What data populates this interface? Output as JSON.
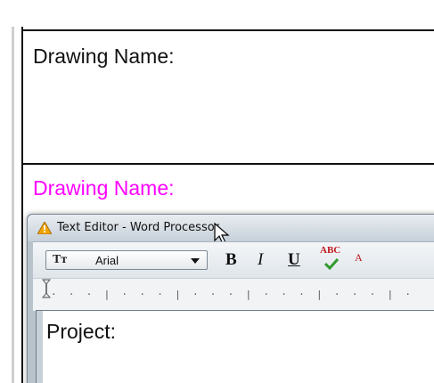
{
  "sheet": {
    "label_black": "Drawing Name:",
    "label_magenta": "Drawing Name:",
    "magenta_color": "#ff00ff"
  },
  "editor": {
    "title": "Text Editor - Word Processor",
    "app_icon": "warning-icon",
    "toolbar": {
      "font_icon": "font-icon",
      "font_glyph": "Tт",
      "font_name": "Arial",
      "bold_label": "B",
      "italic_label": "I",
      "underline_label": "U",
      "spell_label": "ABC",
      "size_label": "A"
    },
    "ruler": {
      "marks": "·  ·  ·  |  ·  ·  ·  |  ·  ·  ·  |  ·  ·  ·  |  ·  ·  ·  |  ·"
    },
    "document": {
      "text": "Project:"
    }
  }
}
